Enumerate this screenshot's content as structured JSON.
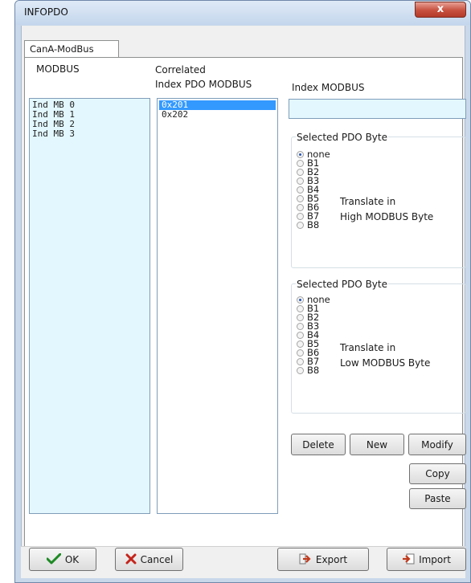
{
  "window": {
    "title": "INFOPDO",
    "close_glyph": "x"
  },
  "tabs": [
    {
      "label": "CanA-ModBus"
    }
  ],
  "modbus": {
    "header": "MODBUS",
    "items": [
      "Ind MB 0",
      "Ind MB 1",
      "Ind MB 2",
      "Ind MB 3"
    ]
  },
  "correlated": {
    "header_line1": "Correlated",
    "header_line2": "Index PDO MODBUS",
    "items": [
      "0x201",
      "0x202"
    ],
    "selected_index": 0
  },
  "index_modbus": {
    "label": "Index MODBUS",
    "value": ""
  },
  "high_group": {
    "title": "Selected PDO Byte",
    "options": [
      "none",
      "B1",
      "B2",
      "B3",
      "B4",
      "B5",
      "B6",
      "B7",
      "B8"
    ],
    "selected": "none",
    "caption_line1": "Translate in",
    "caption_line2": "High MODBUS Byte"
  },
  "low_group": {
    "title": "Selected PDO Byte",
    "options": [
      "none",
      "B1",
      "B2",
      "B3",
      "B4",
      "B5",
      "B6",
      "B7",
      "B8"
    ],
    "selected": "none",
    "caption_line1": "Translate in",
    "caption_line2": "Low MODBUS Byte"
  },
  "actions": {
    "delete": "Delete",
    "new": "New",
    "modify": "Modify",
    "copy": "Copy",
    "paste": "Paste"
  },
  "footer": {
    "ok": "OK",
    "cancel": "Cancel",
    "export": "Export",
    "import": "Import"
  },
  "icons": {
    "ok": "check-icon",
    "cancel": "x-mark-icon",
    "export": "export-arrow-icon",
    "import": "import-icon"
  },
  "colors": {
    "list_bg": "#e3f8fe",
    "selection": "#3399ff",
    "close_red": "#c7503f"
  }
}
